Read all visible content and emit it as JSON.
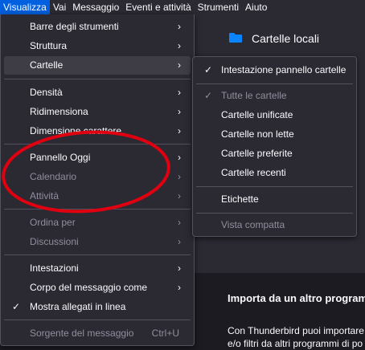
{
  "menubar": {
    "items": [
      "Visualizza",
      "Vai",
      "Messaggio",
      "Eventi e attività",
      "Strumenti",
      "Aiuto"
    ]
  },
  "background": {
    "folder_title": "Cartelle locali",
    "import_title": "Importa da un altro program",
    "import_text_1": "Con Thunderbird puoi importare",
    "import_text_2": "e/o filtri da altri programmi di po"
  },
  "view_menu": {
    "items": [
      {
        "label": "Barre degli strumenti"
      },
      {
        "label": "Struttura"
      },
      {
        "label": "Cartelle"
      },
      {
        "label": "Densità"
      },
      {
        "label": "Ridimensiona"
      },
      {
        "label": "Dimensione carattere"
      },
      {
        "label": "Pannello Oggi"
      },
      {
        "label": "Calendario"
      },
      {
        "label": "Attività"
      },
      {
        "label": "Ordina per"
      },
      {
        "label": "Discussioni"
      },
      {
        "label": "Intestazioni"
      },
      {
        "label": "Corpo del messaggio come"
      },
      {
        "label": "Mostra allegati in linea"
      },
      {
        "label": "Sorgente del messaggio",
        "shortcut": "Ctrl+U"
      }
    ]
  },
  "folders_submenu": {
    "items": [
      {
        "label": "Intestazione pannello cartelle"
      },
      {
        "label": "Tutte le cartelle"
      },
      {
        "label": "Cartelle unificate"
      },
      {
        "label": "Cartelle non lette"
      },
      {
        "label": "Cartelle preferite"
      },
      {
        "label": "Cartelle recenti"
      },
      {
        "label": "Etichette"
      },
      {
        "label": "Vista compatta"
      }
    ]
  },
  "icons": {
    "submenu_arrow": "chevron-right-icon",
    "checkmark": "checkmark-icon",
    "folder": "folder-icon"
  },
  "colors": {
    "accent": "#0060df",
    "annotation": "#e0000f",
    "folder": "#0a84ff"
  }
}
